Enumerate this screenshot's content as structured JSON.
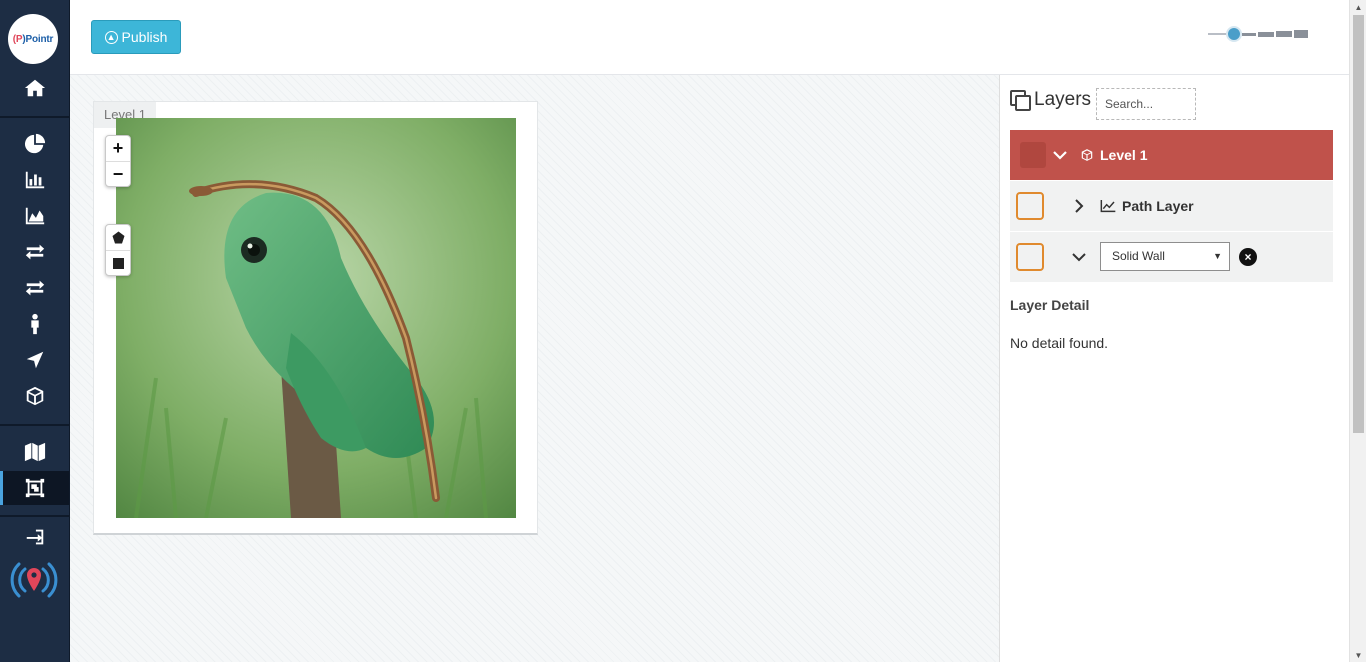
{
  "app": {
    "logo_text_prefix": "(",
    "logo_text_mid": "P",
    "logo_text": ")Pointr",
    "accent": "#3db6d8",
    "sidebar_bg": "#1d2d44",
    "level_color": "#c0524b"
  },
  "sidebar": {
    "items": [
      {
        "name": "home",
        "icon": "home-icon"
      },
      {
        "name": "dashboard",
        "icon": "pie-chart-icon"
      },
      {
        "name": "reports",
        "icon": "bar-chart-icon"
      },
      {
        "name": "analytics",
        "icon": "area-chart-icon"
      },
      {
        "name": "transfers-a",
        "icon": "exchange-icon"
      },
      {
        "name": "transfers-b",
        "icon": "exchange-icon"
      },
      {
        "name": "people",
        "icon": "person-icon"
      },
      {
        "name": "navigation",
        "icon": "location-arrow-icon"
      },
      {
        "name": "objects",
        "icon": "cube-icon"
      },
      {
        "name": "maps",
        "icon": "map-icon"
      },
      {
        "name": "map-editor",
        "icon": "object-group-icon",
        "active": true
      },
      {
        "name": "logout",
        "icon": "sign-out-icon"
      }
    ]
  },
  "toolbar": {
    "publish_label": "Publish",
    "publish_icon": "arrow-circle-up-icon"
  },
  "canvas": {
    "level_tag": "Level 1",
    "zoom_in": "+",
    "zoom_out": "−",
    "image": "frog-with-lizard-photo"
  },
  "layers": {
    "title": "Layers",
    "search_placeholder": "Search...",
    "rows": {
      "level": "Level 1",
      "path": "Path Layer",
      "wall_select": "Solid Wall"
    },
    "detail_title": "Layer Detail",
    "no_detail": "No detail found."
  }
}
